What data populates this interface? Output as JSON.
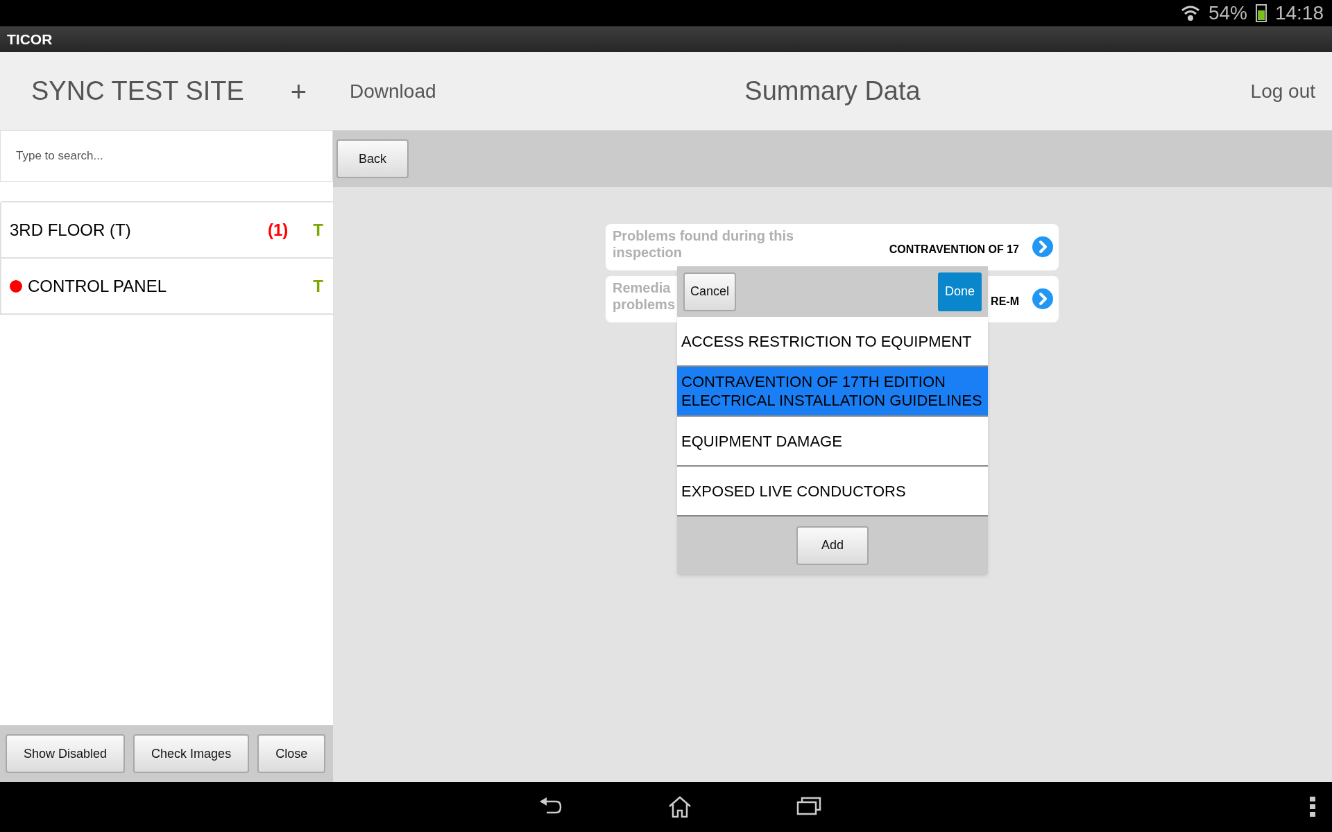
{
  "status_bar": {
    "battery": "54%",
    "time": "14:18"
  },
  "app_bar": {
    "title": "TICOR"
  },
  "sidebar": {
    "title": "SYNC TEST SITE",
    "add": "+",
    "search": {
      "placeholder": "Type to search..."
    },
    "items": [
      {
        "label": "3RD FLOOR (T)",
        "count": "(1)",
        "tag": "T",
        "dot": false
      },
      {
        "label": "CONTROL PANEL",
        "tag": "T",
        "dot": true,
        "color": "#ff0000"
      }
    ],
    "buttons": [
      "Show Disabled",
      "Check Images",
      "Close"
    ]
  },
  "header": {
    "left": "Download",
    "title": "Summary Data",
    "right": "Log out"
  },
  "toolbar": {
    "back": "Back"
  },
  "cards": [
    {
      "label_lines": [
        "Problems found during this",
        "inspection"
      ],
      "value": "CONTRAVENTION OF 17"
    },
    {
      "label_lines": [
        "Remedia",
        "problems"
      ],
      "value": "RE-M"
    }
  ],
  "dialog": {
    "cancel": "Cancel",
    "done": "Done",
    "options": [
      {
        "label": "ACCESS RESTRICTION TO EQUIPMENT",
        "selected": false
      },
      {
        "label": "CONTRAVENTION OF 17TH EDITION ELECTRICAL INSTALLATION GUIDELINES",
        "selected": true
      },
      {
        "label": "EQUIPMENT DAMAGE",
        "selected": false
      },
      {
        "label": "EXPOSED LIVE CONDUCTORS",
        "selected": false
      }
    ],
    "add": "Add"
  }
}
